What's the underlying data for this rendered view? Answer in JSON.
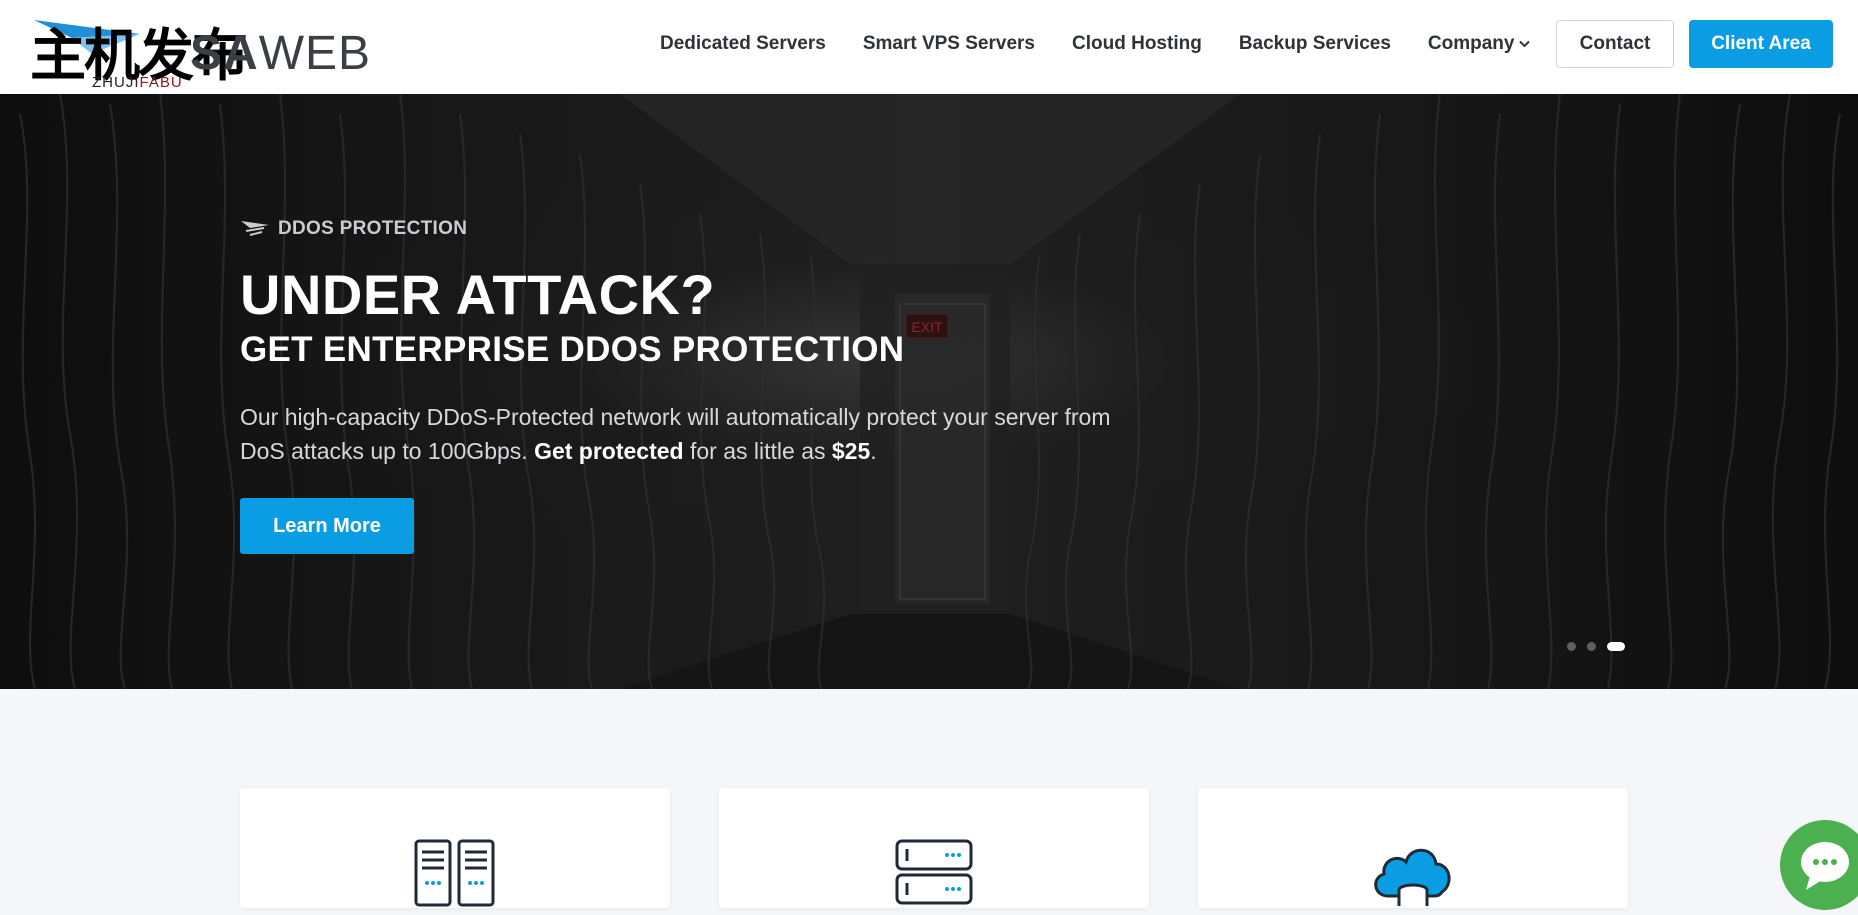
{
  "logo": {
    "watermark_text": "主机发布",
    "watermark_sub_left": "ZHUJI",
    "watermark_sub_right": "FABU",
    "brand_bold": "SA",
    "brand_light": "WEB"
  },
  "nav": {
    "items": [
      {
        "label": "Dedicated Servers"
      },
      {
        "label": "Smart VPS Servers"
      },
      {
        "label": "Cloud Hosting"
      },
      {
        "label": "Backup Services"
      },
      {
        "label": "Company",
        "has_dropdown": true
      }
    ],
    "contact_label": "Contact",
    "client_area_label": "Client Area"
  },
  "hero": {
    "eyebrow": "DDOS PROTECTION",
    "title": "UNDER ATTACK?",
    "subtitle": "GET ENTERPRISE DDOS PROTECTION",
    "description_part1": "Our high-capacity DDoS-Protected network will automatically protect your server from DoS attacks up to 100Gbps. ",
    "description_bold1": "Get protected",
    "description_part2": " for as little as ",
    "description_bold2": "$25",
    "description_part3": ".",
    "cta_label": "Learn More",
    "slides_total": 3,
    "active_slide": 3,
    "exit_sign": "EXIT"
  },
  "cards": [
    {
      "icon": "dedicated-servers-icon"
    },
    {
      "icon": "vps-server-icon"
    },
    {
      "icon": "cloud-storage-icon"
    }
  ],
  "colors": {
    "accent": "#0a9de3",
    "nav_text": "#2f3237",
    "page_bg": "#f4f6f9",
    "chat": "#4caf50"
  }
}
